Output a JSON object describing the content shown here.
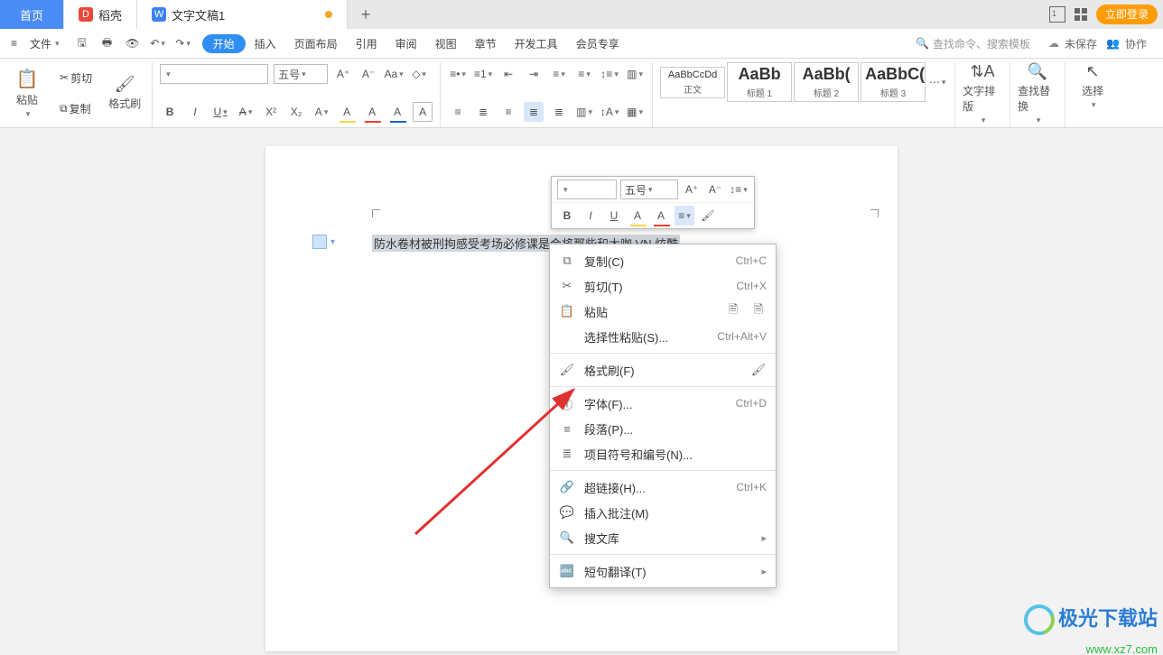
{
  "titlebar": {
    "home": "首页",
    "app_name": "稻壳",
    "doc_name": "文字文稿1",
    "add": "+",
    "login": "立即登录"
  },
  "menubar": {
    "file": "文件",
    "tabs": {
      "start": "开始",
      "insert": "插入",
      "layout": "页面布局",
      "reference": "引用",
      "review": "审阅",
      "view": "视图",
      "chapter": "章节",
      "dev": "开发工具",
      "member": "会员专享"
    },
    "search_placeholder": "查找命令、搜索模板",
    "unsaved": "未保存",
    "coop": "协作"
  },
  "ribbon": {
    "paste": "粘贴",
    "cut": "剪切",
    "copy": "复制",
    "fmtpaint": "格式刷",
    "font_name": "",
    "font_size": "五号",
    "styles": [
      {
        "preview": "AaBbCcDd",
        "label": "正文",
        "big": false
      },
      {
        "preview": "AaBb",
        "label": "标题 1",
        "big": true
      },
      {
        "preview": "AaBb(",
        "label": "标题 2",
        "big": true
      },
      {
        "preview": "AaBbC(",
        "label": "标题 3",
        "big": true
      }
    ],
    "text_layout": "文字排版",
    "find_replace": "查找替换",
    "select": "选择"
  },
  "document": {
    "selected_text": "防水卷材被刑拘感受考场必修课是会将那些和大咖 VN 炫酷"
  },
  "minibar": {
    "font_name": "",
    "font_size": "五号",
    "inc": "A⁺",
    "dec": "A⁻"
  },
  "ctxmenu": {
    "copy": {
      "label": "复制(C)",
      "sc": "Ctrl+C"
    },
    "cut": {
      "label": "剪切(T)",
      "sc": "Ctrl+X"
    },
    "paste": {
      "label": "粘贴",
      "sc": ""
    },
    "paste_special": {
      "label": "选择性粘贴(S)...",
      "sc": "Ctrl+Alt+V"
    },
    "fmt": {
      "label": "格式刷(F)",
      "sc": ""
    },
    "font": {
      "label": "字体(F)...",
      "sc": "Ctrl+D"
    },
    "para": {
      "label": "段落(P)...",
      "sc": ""
    },
    "bullets": {
      "label": "项目符号和编号(N)...",
      "sc": ""
    },
    "link": {
      "label": "超链接(H)...",
      "sc": "Ctrl+K"
    },
    "comment": {
      "label": "插入批注(M)",
      "sc": ""
    },
    "searchlib": {
      "label": "搜文库",
      "sc": ""
    },
    "translate": {
      "label": "短句翻译(T)",
      "sc": ""
    }
  },
  "watermark": {
    "line1": "极光下载站",
    "line2": "www.xz7.com"
  }
}
